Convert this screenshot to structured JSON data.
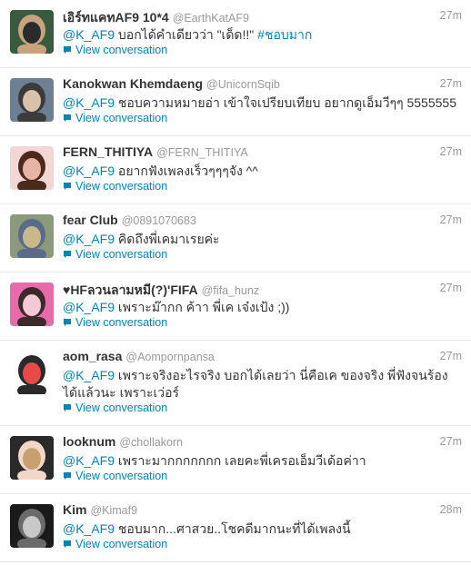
{
  "stream": {
    "tweets": [
      {
        "fullname": "เอิร์ทแคทAF9 10*4",
        "username": "@EarthKatAF9",
        "time": "27m",
        "mention": "@K_AF9",
        "text": " บอกได้คำเดียวว่า \"เด็ด!!\" ",
        "hashtag": "#ชอบมาก",
        "expand": "View conversation",
        "avatar_colors": [
          "#3a5a40",
          "#c9a27e",
          "#2b2b2b"
        ]
      },
      {
        "fullname": "Kanokwan Khemdaeng",
        "username": "@UnicornSqib",
        "time": "27m",
        "mention": "@K_AF9",
        "text": " ชอบความหมายอ่า เข้าใจเปรียบเทียบ อยากดูเอ็มวีๆๆ 5555555",
        "hashtag": "",
        "expand": "View conversation",
        "avatar_colors": [
          "#6d7f93",
          "#3b3b3b",
          "#d8c2a8"
        ]
      },
      {
        "fullname": "FERN_THITIYA",
        "username": "@FERN_THITIYA",
        "time": "27m",
        "mention": "@K_AF9",
        "text": " อยากฟังเพลงเร็วๆๆๆจัง ^^",
        "hashtag": "",
        "expand": "View conversation",
        "avatar_colors": [
          "#f2d7d5",
          "#4a2a1a",
          "#e8b4a8"
        ]
      },
      {
        "fullname": "fear Club",
        "username": "@0891070683",
        "time": "27m",
        "mention": "@K_AF9",
        "text": " คิดถึงพี่เคมาเรยค่ะ",
        "hashtag": "",
        "expand": "View conversation",
        "avatar_colors": [
          "#8a9a7a",
          "#5b6b8a",
          "#c8b88a"
        ]
      },
      {
        "fullname": "♥HFลวนลามหมี(?)'FIFA",
        "username": "@fifa_hunz",
        "time": "27m",
        "mention": "@K_AF9",
        "text": " เพราะม๊ากก ค้าา พี่เค เจ๋งเป้ง ;))",
        "hashtag": "",
        "expand": "View conversation",
        "avatar_colors": [
          "#e86aa8",
          "#3a2a2a",
          "#f5c8d8"
        ]
      },
      {
        "fullname": "aom_rasa",
        "username": "@Aompornpansa",
        "time": "27m",
        "mention": "@K_AF9",
        "text": " เพราะจริงอะไรจริง บอกได้เลยว่า นี่คือเค ของจริง พี่ฟังจนร้องได้แล้วนะ เพราะเว่อร์",
        "hashtag": "",
        "expand": "View conversation",
        "avatar_colors": [
          "#ffffff",
          "#2a2a2a",
          "#e84a4a"
        ]
      },
      {
        "fullname": "looknum",
        "username": "@chollakorn",
        "time": "27m",
        "mention": "@K_AF9",
        "text": " เพราะมากกกกกกก เลยคะพี่เครอเอ็มวีเด้อค่าา",
        "hashtag": "",
        "expand": "View conversation",
        "avatar_colors": [
          "#2a2a2a",
          "#f0d8c8",
          "#c8a070"
        ]
      },
      {
        "fullname": "Kim",
        "username": "@Kimaf9",
        "time": "28m",
        "mention": "@K_AF9",
        "text": " ชอบมาก...ศาสวย..โชคดีมากนะที่ได้เพลงนี้",
        "hashtag": "",
        "expand": "View conversation",
        "avatar_colors": [
          "#1a1a1a",
          "#6a6a6a",
          "#c8c8c8"
        ]
      }
    ]
  }
}
